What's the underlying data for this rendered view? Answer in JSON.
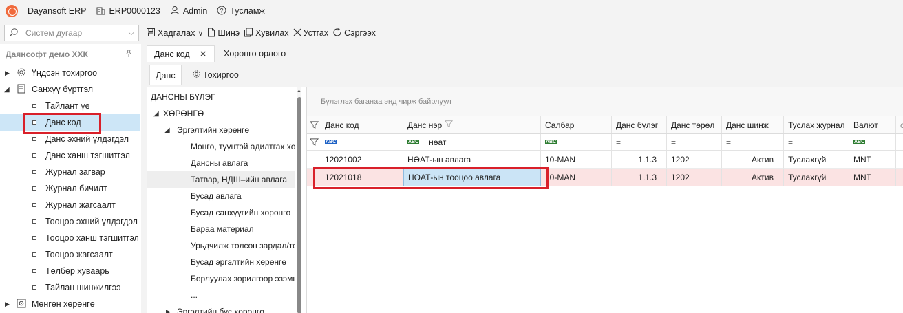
{
  "titlebar": {
    "app_name": "Dayansoft ERP",
    "company_code": "ERP0000123",
    "user": "Admin",
    "help": "Тусламж"
  },
  "commandbar": {
    "search_placeholder": "Систем дугаар",
    "commands": [
      {
        "label": "Хадгалах",
        "icon": "save-icon"
      },
      {
        "label": "Шинэ",
        "icon": "new-file-icon"
      },
      {
        "label": "Хувилах",
        "icon": "copy-icon"
      },
      {
        "label": "Устгах",
        "icon": "delete-x-icon"
      },
      {
        "label": "Сэргээх",
        "icon": "refresh-icon"
      }
    ]
  },
  "sidebar": {
    "organization": "Даянсофт демо ХХК",
    "items": [
      {
        "label": "Үндсэн тохиргоо",
        "level": 0,
        "icon": "gear-icon",
        "expanded": false
      },
      {
        "label": "Санхүү бүртгэл",
        "level": 0,
        "icon": "ledger-icon",
        "expanded": true
      },
      {
        "label": "Тайлант үе",
        "level": 1
      },
      {
        "label": "Данс код",
        "level": 1,
        "selected": true
      },
      {
        "label": "Данс эхний үлдэгдэл",
        "level": 1
      },
      {
        "label": "Данс ханш тэгшитгэл",
        "level": 1
      },
      {
        "label": "Журнал загвар",
        "level": 1
      },
      {
        "label": "Журнал бичилт",
        "level": 1
      },
      {
        "label": "Журнал жагсаалт",
        "level": 1
      },
      {
        "label": "Тооцоо эхний үлдэгдэл",
        "level": 1
      },
      {
        "label": "Тооцоо ханш тэгшитгэл",
        "level": 1
      },
      {
        "label": "Тооцоо жагсаалт",
        "level": 1
      },
      {
        "label": "Төлбөр хуваарь",
        "level": 1
      },
      {
        "label": "Тайлан шинжилгээ",
        "level": 1
      },
      {
        "label": "Мөнгөн хөрөнгө",
        "level": 0,
        "icon": "cash-icon",
        "expanded": false
      }
    ]
  },
  "doc_tabs": [
    {
      "label": "Данс код",
      "active": true
    },
    {
      "label": "Хөрөнгө орлого",
      "active": false
    }
  ],
  "sub_tabs": [
    {
      "label": "Данс",
      "active": true
    },
    {
      "label": "Тохиргоо",
      "active": false
    }
  ],
  "tree": {
    "root": "ДАНСНЫ БҮЛЭГ",
    "nodes": [
      {
        "label": "ХӨРӨНГӨ",
        "level": 1,
        "expanded": true
      },
      {
        "label": "Эргэлтийн хөрөнгө",
        "level": 2,
        "expanded": true
      },
      {
        "label": "Мөнгө, түүнтэй адилтгах хө",
        "level": 3
      },
      {
        "label": "Дансны авлага",
        "level": 3
      },
      {
        "label": "Татвар, НДШ–ийн авлага",
        "level": 3,
        "highlighted": true
      },
      {
        "label": "Бусад авлага",
        "level": 3
      },
      {
        "label": "Бусад санхүүгийн хөрөнгө",
        "level": 3
      },
      {
        "label": "Бараа материал",
        "level": 3
      },
      {
        "label": "Урьдчилж төлсөн зардал/тс",
        "level": 3
      },
      {
        "label": "Бусад эргэлтийн хөрөнгө",
        "level": 3
      },
      {
        "label": "Борлуулах зорилгоор эзэмш",
        "level": 3
      },
      {
        "label": "...",
        "level": 3
      },
      {
        "label": "Эргэлтийн бус хөрөнгө",
        "level": 2,
        "expanded": false
      }
    ]
  },
  "grid": {
    "group_panel_hint": "Бүлэглэх баганаа энд чирж байрлуул",
    "columns": [
      "Данс код",
      "Данс нэр",
      "Салбар",
      "Данс бүлэг",
      "Данс төрөл",
      "Данс шинж",
      "Туслах журнал",
      "Валют"
    ],
    "filter_row": {
      "dans_ner": "нөат",
      "text_badge": "ABC",
      "equals_sign": "="
    },
    "rows": [
      {
        "code": "12021002",
        "name": "НӨАТ-ын авлага",
        "branch": "10-MAN",
        "group": "1.1.3",
        "type": "1202",
        "attribute": "Актив",
        "aux_journal": "Туслахгүй",
        "currency": "MNT",
        "selected": false
      },
      {
        "code": "12021018",
        "name": "НӨАТ-ын тооцоо авлага",
        "branch": "10-MAN",
        "group": "1.1.3",
        "type": "1202",
        "attribute": "Актив",
        "aux_journal": "Туслахгүй",
        "currency": "MNT",
        "selected": true
      }
    ]
  }
}
